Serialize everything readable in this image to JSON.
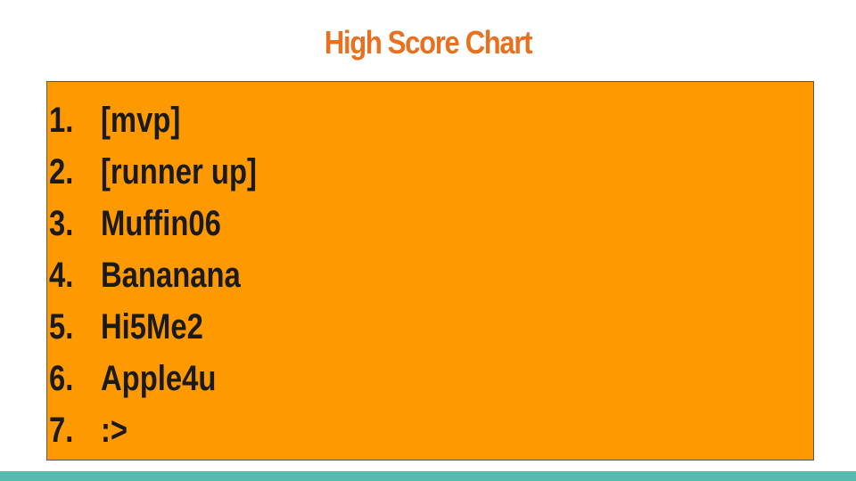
{
  "slide": {
    "title": "High Score Chart",
    "colors": {
      "title": "#e8711f",
      "box_fill": "#ff9900",
      "box_border": "#595959",
      "text": "#1a1a1a",
      "footer_bar": "#57bbb0"
    }
  },
  "scores": [
    {
      "rank": "1.",
      "name": "[mvp]"
    },
    {
      "rank": "2.",
      "name": "[runner up]"
    },
    {
      "rank": "3.",
      "name": "Muffin06"
    },
    {
      "rank": "4.",
      "name": "Bananana"
    },
    {
      "rank": "5.",
      "name": "Hi5Me2"
    },
    {
      "rank": "6.",
      "name": "Apple4u"
    },
    {
      "rank": "7.",
      "name": ":>"
    }
  ]
}
